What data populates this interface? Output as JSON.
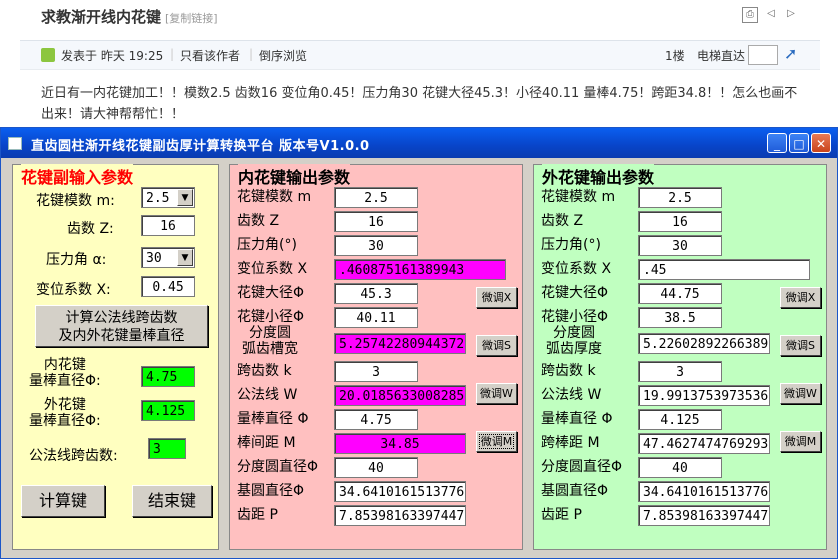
{
  "forum": {
    "title": "求教渐开线内花键",
    "copy_link": "[复制链接]",
    "posted": "发表于 昨天 19:25",
    "author_only": "只看该作者",
    "reverse": "倒序浏览",
    "floor": "1楼",
    "elevator": "电梯直达",
    "body": "近日有一内花键加工！！模数2.5 齿数16 变位角0.45！压力角30 花键大径45.3！小径40.11  量棒4.75！跨距34.8！！怎么也画不出来！请大神帮帮忙！！"
  },
  "window": {
    "title": "直齿圆柱渐开线花键副齿厚计算转换平台   版本号V1.0.0",
    "min": "_",
    "max": "□",
    "close": "✕"
  },
  "input_panel": {
    "title": "花键副输入参数",
    "module_label": "花键模数 m:",
    "module_value": "2.5",
    "teeth_label": "齿数 Z:",
    "teeth_value": "16",
    "angle_label": "压力角 α:",
    "angle_value": "30",
    "shift_label": "变位系数 X:",
    "shift_value": "0.45",
    "calc_span_button": "计算公法线跨齿数\n及内外花键量棒直径",
    "inner_pin_label": "内花键\n量棒直径Φ:",
    "inner_pin_value": "4.75",
    "outer_pin_label": "外花键\n量棒直径Φ:",
    "outer_pin_value": "4.125",
    "span_teeth_label": "公法线跨齿数:",
    "span_teeth_value": "3",
    "calc_button": "计算键",
    "end_button": "结束键"
  },
  "inner_panel": {
    "title": "内花键输出参数",
    "rows": [
      {
        "label": "花键模数 m",
        "value": "2.5"
      },
      {
        "label": "齿数  Z",
        "value": "16"
      },
      {
        "label": "压力角(°)",
        "value": "30"
      },
      {
        "label": "变位系数 X",
        "value": ".460875161389943"
      },
      {
        "label": "花键大径Φ",
        "value": "45.3"
      },
      {
        "label": "花键小径Φ",
        "value": "40.11"
      },
      {
        "label": "分度圆\n弧齿槽宽",
        "value": "5.25742280944372"
      },
      {
        "label": "跨齿数 k",
        "value": "3"
      },
      {
        "label": "公法线 W",
        "value": "20.0185633008285"
      },
      {
        "label": "量棒直径 Φ",
        "value": "4.75"
      },
      {
        "label": "棒间距 M",
        "value": "34.85"
      },
      {
        "label": "分度圆直径Φ",
        "value": "40"
      },
      {
        "label": "基圆直径Φ",
        "value": "34.6410161513776"
      },
      {
        "label": "齿距 P",
        "value": "7.85398163397447"
      }
    ],
    "adjust_x": "微调X",
    "adjust_s": "微调S",
    "adjust_w": "微调W",
    "adjust_m": "微调M"
  },
  "outer_panel": {
    "title": "外花键输出参数",
    "rows": [
      {
        "label": "花键模数 m",
        "value": "2.5"
      },
      {
        "label": "齿数  Z",
        "value": "16"
      },
      {
        "label": "压力角(°)",
        "value": "30"
      },
      {
        "label": "变位系数 X",
        "value": ".45"
      },
      {
        "label": "花键大径Φ",
        "value": "44.75"
      },
      {
        "label": "花键小径Φ",
        "value": "38.5"
      },
      {
        "label": "分度圆\n弧齿厚度",
        "value": "5.22602892266389"
      },
      {
        "label": "跨齿数 k",
        "value": "3"
      },
      {
        "label": "公法线 W",
        "value": "19.9913753973536"
      },
      {
        "label": "量棒直径 Φ",
        "value": "4.125"
      },
      {
        "label": "跨棒距 M",
        "value": "47.4627474769293"
      },
      {
        "label": "分度圆直径Φ",
        "value": "40"
      },
      {
        "label": "基圆直径Φ",
        "value": "34.6410161513776"
      },
      {
        "label": "齿距 P",
        "value": "7.85398163397447"
      }
    ],
    "adjust_x": "微调X",
    "adjust_s": "微调S",
    "adjust_w": "微调W",
    "adjust_m": "微调M"
  },
  "colors": {
    "input_bg": "#ffffc0",
    "inner_bg": "#ffc0c0",
    "outer_bg": "#c0ffc0",
    "highlight_magenta": "#ff00ff",
    "highlight_green": "#00ff00",
    "title_red": "#ff0000",
    "titlebar_blue": "#0a5ff0"
  }
}
